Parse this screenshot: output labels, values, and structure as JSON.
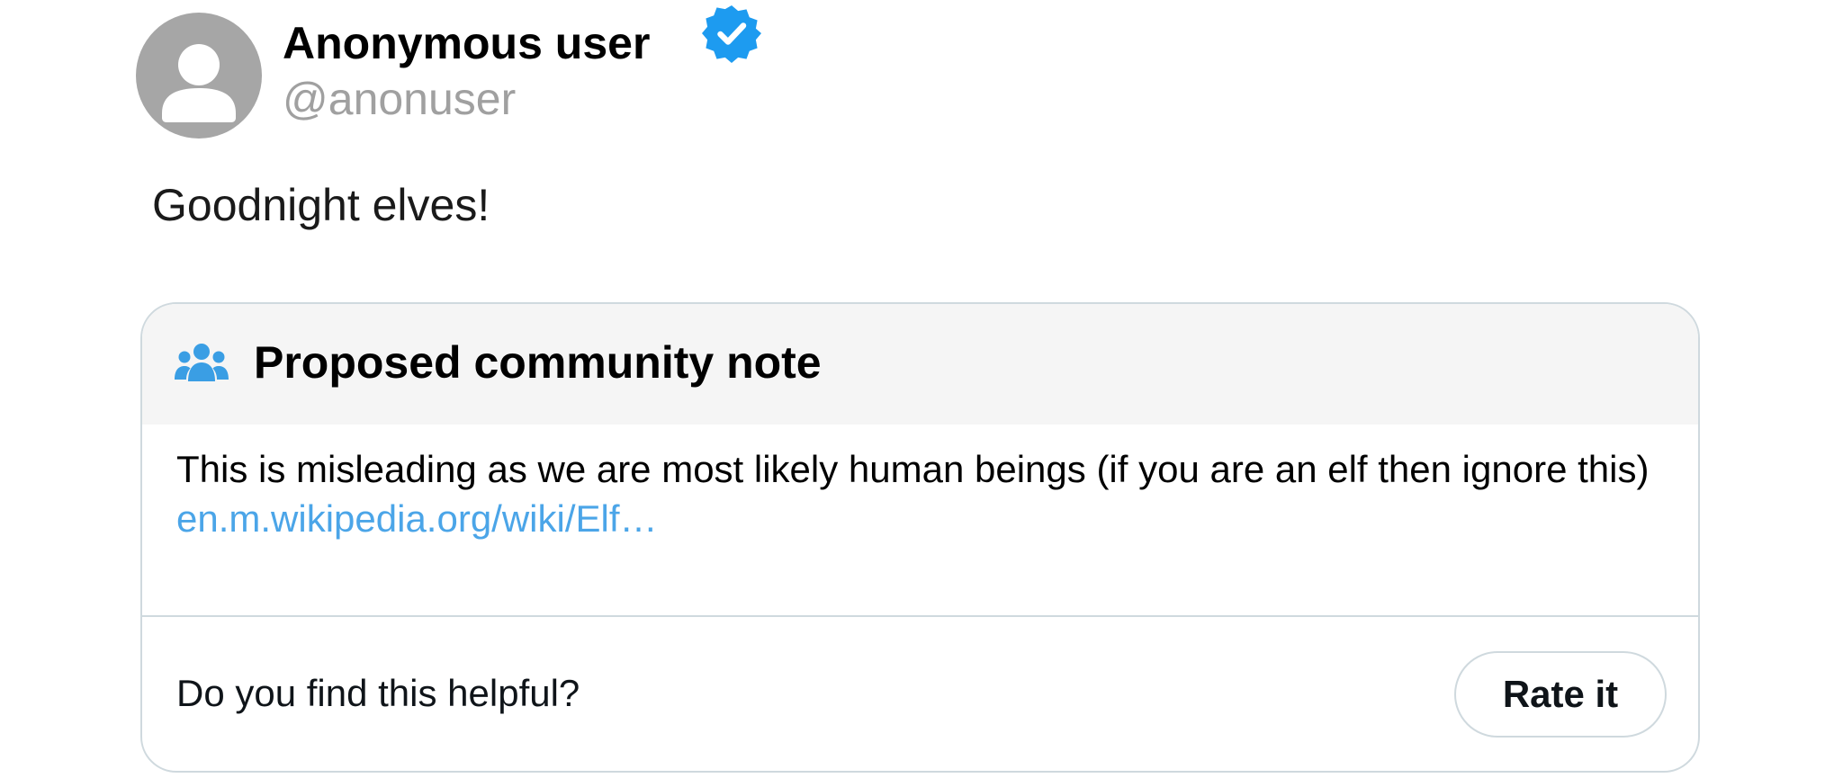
{
  "author": {
    "display_name": "Anonymous user",
    "handle": "@anonuser",
    "verified": true,
    "avatar_icon": "default-user-icon",
    "avatar_color": "#a6a6a6"
  },
  "tweet": {
    "text": "Goodnight elves!"
  },
  "community_note": {
    "icon": "community-people-icon",
    "title": "Proposed community note",
    "body": "This is misleading as we are most likely human beings (if you are an elf then ignore this)",
    "link_text": "en.m.wikipedia.org/wiki/Elf…",
    "helpful_question": "Do you find this helpful?",
    "rate_button_label": "Rate it"
  },
  "colors": {
    "verified_badge": "#1d9bf0",
    "link": "#4ba5e8",
    "community_icon": "#3a9ee4",
    "handle_text": "#a0a0a0",
    "note_header_bg": "#f5f5f5",
    "border": "#cfd9de"
  }
}
